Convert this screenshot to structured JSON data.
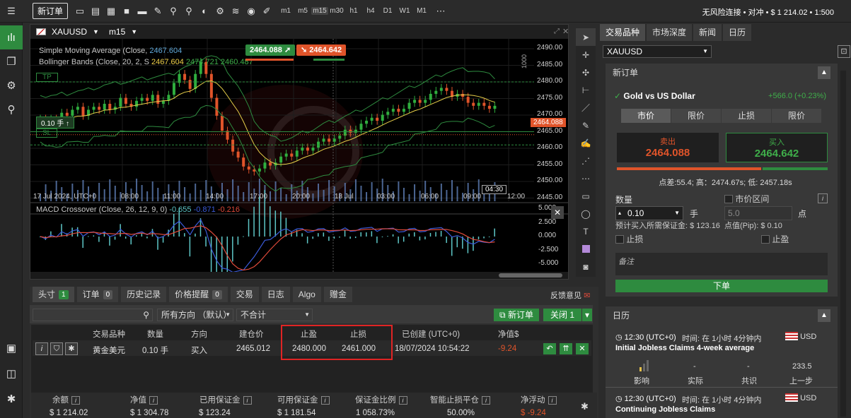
{
  "toolbar": {
    "new_order": "新订单",
    "timeframes": [
      "m1",
      "m5",
      "m15",
      "m30",
      "h1",
      "h4",
      "D1",
      "W1",
      "M1"
    ],
    "selected_timeframe": "m15",
    "account_status": "无风险连接 • 对冲 • $ 1 214.02 • 1:500"
  },
  "chart": {
    "symbol": "XAUUSD",
    "timeframe": "m15",
    "sma_label": "Simple Moving Average (Close,",
    "sma_value": "2467.604",
    "bb_label": "Bollinger Bands (Close, 20, 2, S",
    "bb_values": [
      "2467.604",
      "2474.721",
      "2460.487"
    ],
    "sell_badge": "2464.088",
    "buy_badge": "2464.642",
    "current_price": "2464.088",
    "tp_label": "TP",
    "sl_label": "SL",
    "position_label": "0.10 手",
    "price_ticks": [
      "2490.00",
      "2485.00",
      "2480.00",
      "2475.00",
      "2470.00",
      "2465.00",
      "2460.00",
      "2455.00",
      "2450.00",
      "2445.00"
    ],
    "time_ticks": [
      "17 Jul 2024, UTC+0",
      "08:00",
      "11:00",
      "14:00",
      "17:00",
      "20:00",
      "18 Jul",
      "03:00",
      "06:00",
      "09:00",
      "12:00"
    ],
    "cursor_time": "04:30",
    "vol_axis_label": "1000",
    "macd_label": "MACD Crossover (Close, 26, 12, 9, 0)",
    "macd_values": [
      "-0.655",
      "-0.871",
      "-0.216"
    ],
    "macd_ticks": [
      "5.000",
      "2.500",
      "0.000",
      "-2.500",
      "-5.000"
    ]
  },
  "right": {
    "tabs": [
      "交易品种",
      "市场深度",
      "新闻",
      "日历"
    ],
    "symbol_select": "XAUUSD",
    "new_order_title": "新订单",
    "instrument_name": "Gold vs US Dollar",
    "change": "+566.0 (+0.23%)",
    "order_types": [
      "市价",
      "限价",
      "止损",
      "限价"
    ],
    "sell_label": "卖出",
    "sell_price": "2464.088",
    "buy_label": "买入",
    "buy_price": "2464.642",
    "spread_info": "点差:55.4; 高：2474.67s; 低: 2457.18s",
    "qty_label": "数量",
    "market_range_label": "市价区间",
    "qty_value": "0.10",
    "qty_unit": "手",
    "range_value": "5.0",
    "range_unit": "点",
    "margin_info": "预计买入所需保证金: $ 123.16",
    "pip_info": "点值(Pip): $ 0.10",
    "stoploss_label": "止损",
    "takeprofit_label": "止盈",
    "note_placeholder": "备注",
    "place_order": "下单",
    "calendar_title": "日历",
    "events": [
      {
        "time": "12:30 (UTC+0)",
        "rel": "时间: 在 1小时 4分钟内",
        "currency": "USD",
        "title": "Initial Jobless Claims 4-week average",
        "impact": "影响",
        "actual_label": "实际",
        "actual": "-",
        "consensus_label": "共识",
        "consensus": "-",
        "previous_label": "上一步",
        "previous": "233.5"
      },
      {
        "time": "12:30 (UTC+0)",
        "rel": "时间: 在 1小时 4分钟内",
        "currency": "USD",
        "title": "Continuing Jobless Claims"
      }
    ]
  },
  "bottom": {
    "tabs": [
      {
        "label": "头寸",
        "count": "1"
      },
      {
        "label": "订单",
        "count": "0"
      },
      {
        "label": "历史记录"
      },
      {
        "label": "价格提醒",
        "count": "0"
      },
      {
        "label": "交易"
      },
      {
        "label": "日志"
      },
      {
        "label": "Algo"
      },
      {
        "label": "赠金"
      }
    ],
    "feedback": "反馈意见",
    "direction_filter": "所有方向 （默认）",
    "group_filter": "不合计",
    "new_order": "新订单",
    "close_btn": "关闭",
    "close_count": "1",
    "columns": [
      "交易品种",
      "数量",
      "方向",
      "建仓价",
      "止盈",
      "止损",
      "已创建 (UTC+0)",
      "净值$"
    ],
    "row": {
      "symbol": "黄金美元",
      "qty": "0.10 手",
      "dir": "买入",
      "entry": "2465.012",
      "tp": "2480.000",
      "sl": "2461.000",
      "created": "18/07/2024 10:54:22",
      "net": "-9.24"
    },
    "summary": [
      {
        "label": "余额",
        "value": "$ 1 214.02"
      },
      {
        "label": "净值",
        "value": "$ 1 304.78"
      },
      {
        "label": "已用保证金",
        "value": "$ 123.24"
      },
      {
        "label": "可用保证金",
        "value": "$ 1 181.54"
      },
      {
        "label": "保证金比例",
        "value": "1 058.73%"
      },
      {
        "label": "智能止损平仓",
        "value": "50.00%"
      },
      {
        "label": "净浮动",
        "value": "$ -9.24"
      }
    ]
  },
  "colors": {
    "green": "#2e8b3f",
    "red": "#e0542a",
    "highlight": "#e02424"
  }
}
